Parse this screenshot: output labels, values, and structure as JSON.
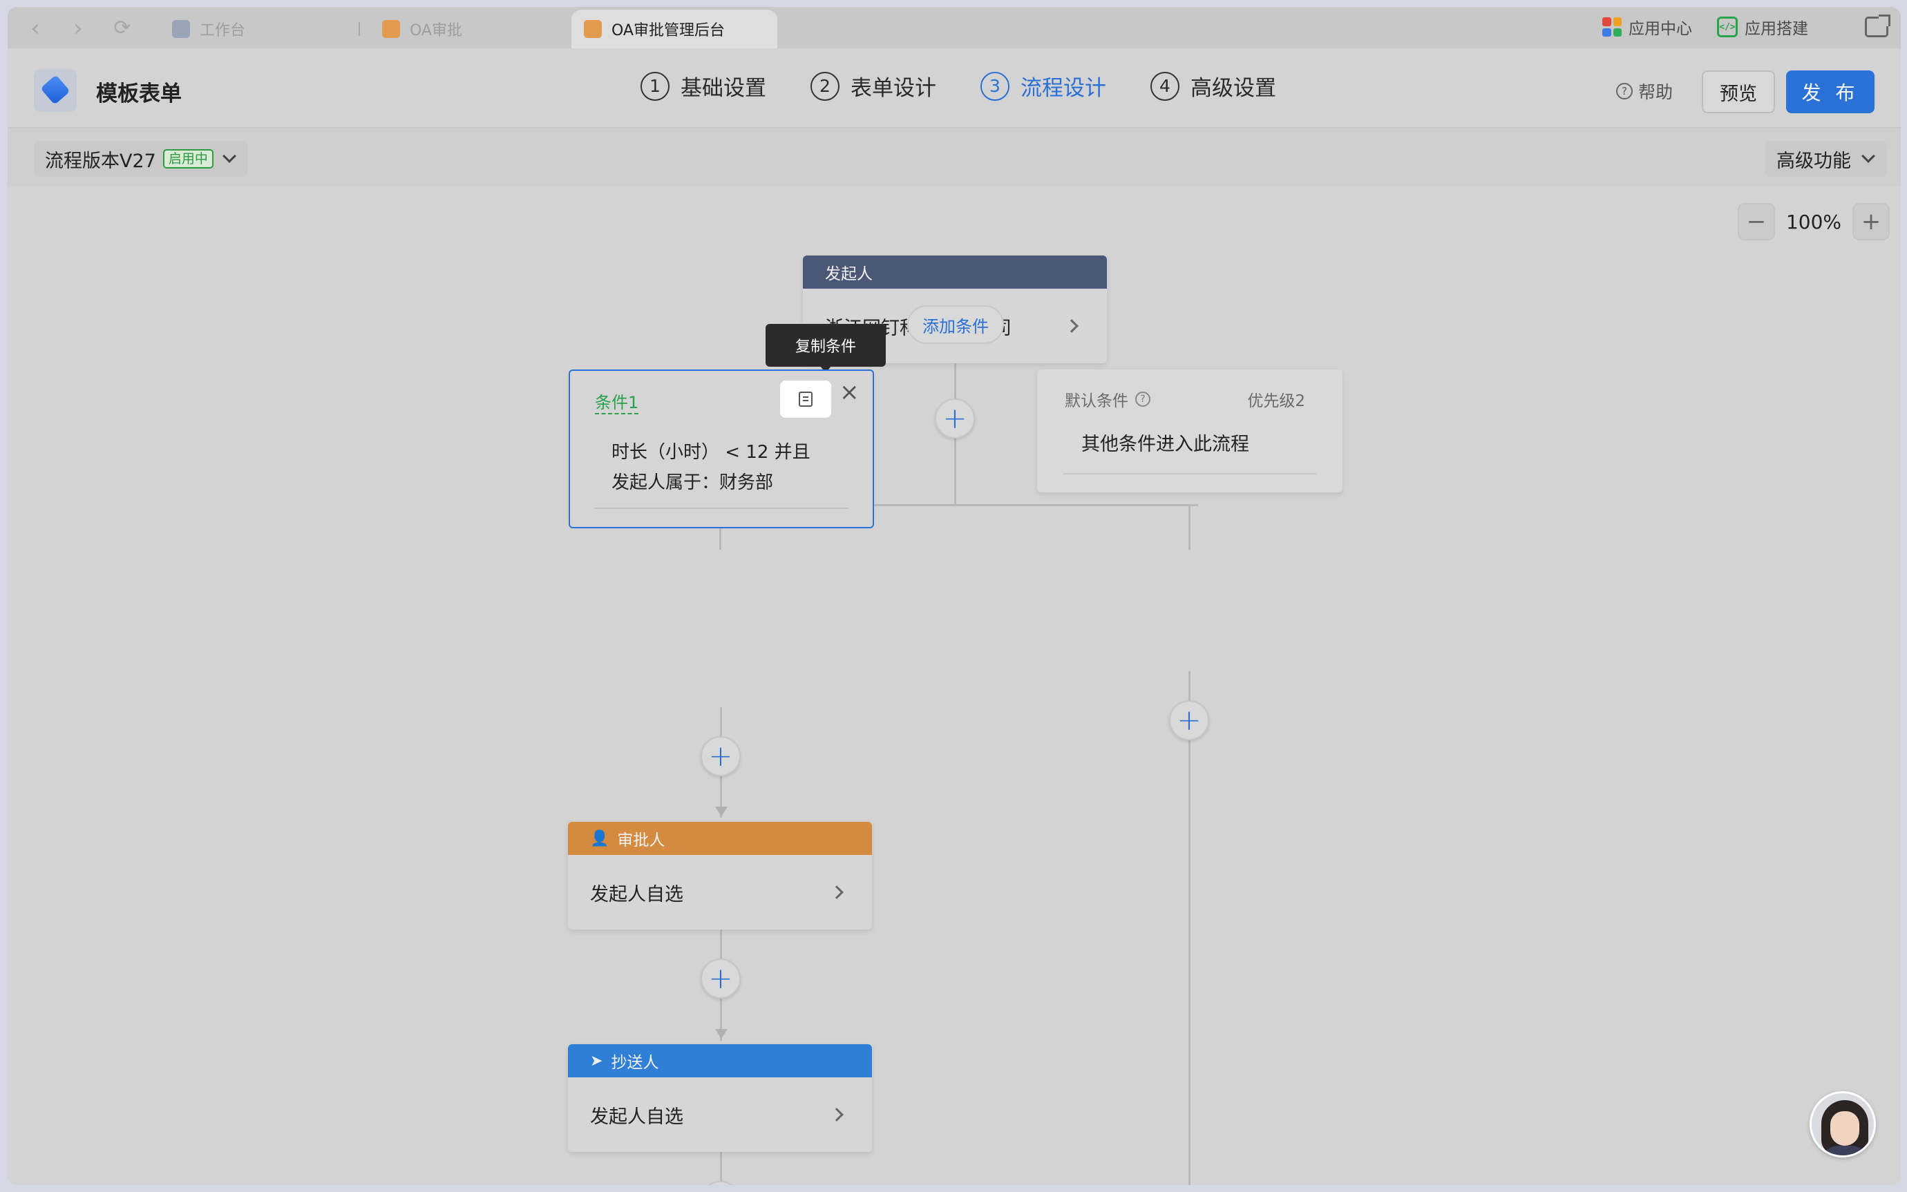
{
  "browser": {
    "tabs": [
      {
        "label": "工作台",
        "active": false
      },
      {
        "label": "OA审批",
        "active": false
      },
      {
        "label": "OA审批管理后台",
        "active": true
      }
    ],
    "right_items": {
      "app_center": "应用中心",
      "app_build": "应用搭建"
    }
  },
  "header": {
    "title": "模板表单",
    "steps": [
      {
        "num": "1",
        "label": "基础设置"
      },
      {
        "num": "2",
        "label": "表单设计"
      },
      {
        "num": "3",
        "label": "流程设计"
      },
      {
        "num": "4",
        "label": "高级设置"
      }
    ],
    "active_step": 3,
    "help": "帮助",
    "preview": "预览",
    "publish": "发 布"
  },
  "toolbar": {
    "version": "流程版本V27",
    "version_status": "启用中",
    "advanced": "高级功能"
  },
  "canvas": {
    "zoom": "100%",
    "initiator": {
      "title": "发起人",
      "value": "浙江网钉科技有限公司"
    },
    "add_condition": "添加条件",
    "tooltip": "复制条件",
    "condition1": {
      "title": "条件1",
      "line1": "时长（小时） < 12 并且",
      "line2": "发起人属于：财务部"
    },
    "default_condition": {
      "title": "默认条件",
      "priority": "优先级2",
      "text": "其他条件进入此流程"
    },
    "approver": {
      "title": "审批人",
      "value": "发起人自选"
    },
    "cc": {
      "title": "抄送人",
      "value": "发起人自选"
    }
  },
  "colors": {
    "accent": "#2a72d8",
    "initiator_header": "#4a5776",
    "approver_header": "#d48a3f",
    "cc_header": "#2f7fd6",
    "condition_title": "#27a34a"
  }
}
